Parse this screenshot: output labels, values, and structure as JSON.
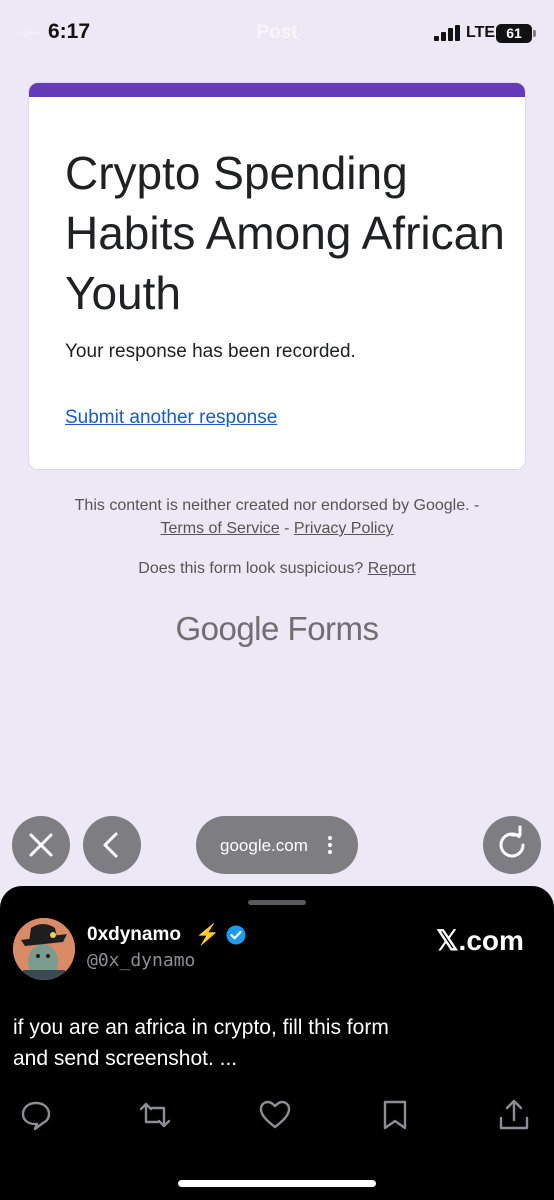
{
  "status_bar": {
    "time": "6:17",
    "title": "Post",
    "network": "LTE",
    "battery": "61"
  },
  "form": {
    "accent_color": "#673ab7",
    "title": "Crypto Spending Habits Among African Youth",
    "confirmation": "Your response has been recorded.",
    "submit_another": "Submit another response"
  },
  "footer": {
    "disclaimer": "This content is neither created nor endorsed by Google. -",
    "terms": "Terms of Service",
    "separator": " - ",
    "privacy": "Privacy Policy",
    "suspicious": "Does this form look suspicious?",
    "report": "Report",
    "logo_google": "Google",
    "logo_forms": "Forms"
  },
  "browser": {
    "url": "google.com",
    "icons": [
      "close-icon",
      "back-icon",
      "more-vertical-icon",
      "reload-icon"
    ]
  },
  "tweet": {
    "display_name": "0xdynamo",
    "emoji": "⚡",
    "handle": "@0x_dynamo",
    "source": "𝕏.com",
    "text": "if you are an africa in crypto, fill this form and send screenshot. ...",
    "actions": [
      "reply-icon",
      "retweet-icon",
      "like-icon",
      "bookmark-icon",
      "share-icon"
    ],
    "verified_color": "#1d9bf0"
  }
}
